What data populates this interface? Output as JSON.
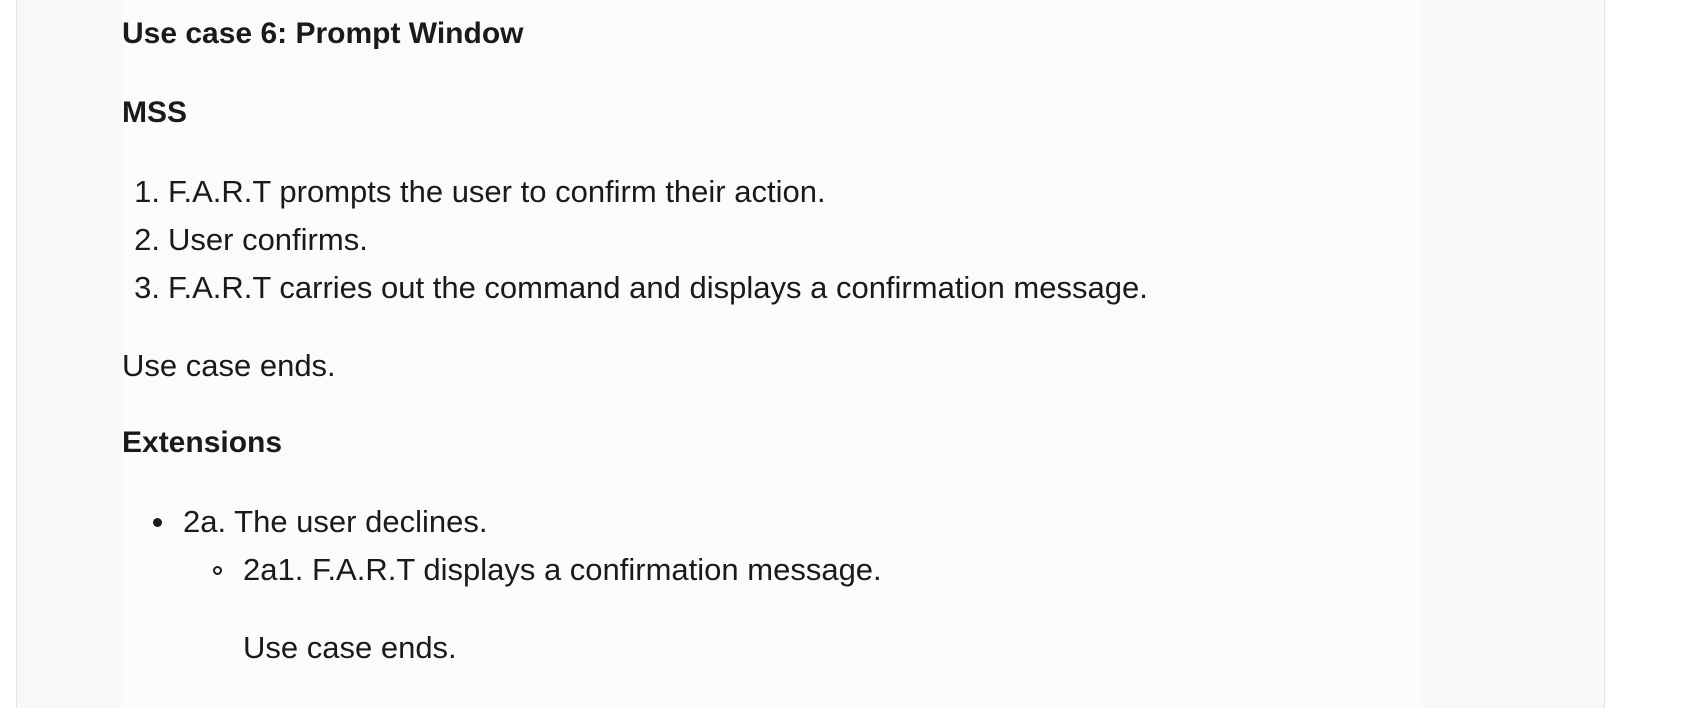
{
  "use_case": {
    "title": "Use case 6: Prompt Window",
    "mss_heading": "MSS",
    "mss_steps": [
      {
        "marker": "1.",
        "text": "F.A.R.T prompts the user to confirm their action."
      },
      {
        "marker": "2.",
        "text": "User confirms."
      },
      {
        "marker": "3.",
        "text": "F.A.R.T carries out the command and displays a confirmation message."
      }
    ],
    "mss_end": "Use case ends.",
    "extensions_heading": "Extensions",
    "extensions": [
      {
        "text": "2a. The user declines.",
        "sub_items": [
          {
            "text": "2a1. F.A.R.T displays a confirmation message.",
            "end": "Use case ends."
          }
        ]
      }
    ]
  }
}
